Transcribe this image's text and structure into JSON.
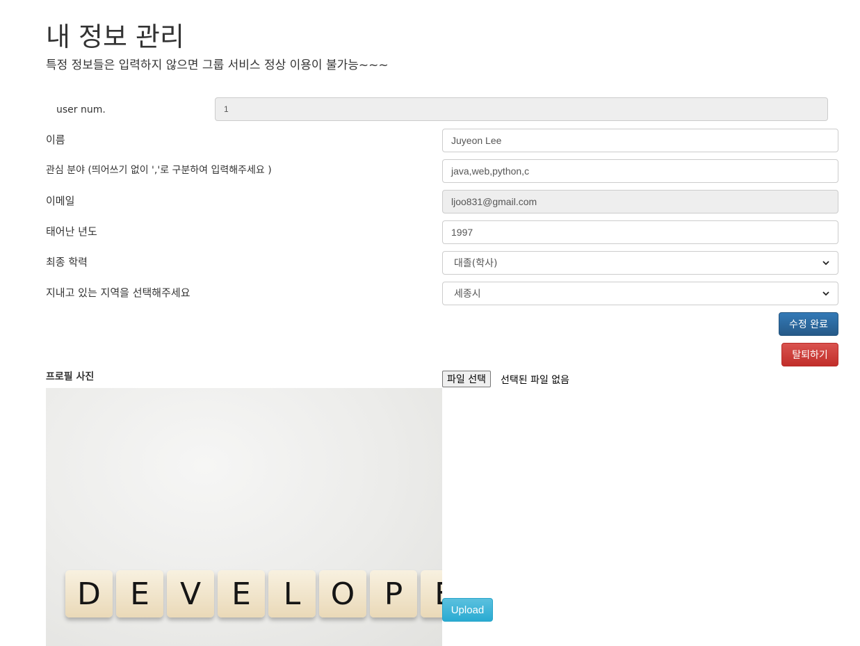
{
  "header": {
    "title": "내 정보 관리",
    "subtitle": "특정 정보들은 입력하지 않으면 그룹 서비스 정상 이용이 불가능~~~"
  },
  "form": {
    "user_num": {
      "label": "user num.",
      "value": "1"
    },
    "name": {
      "label": "이름",
      "value": "Juyeon Lee"
    },
    "interests": {
      "label": "관심 분야 (띄어쓰기 없이 ','로 구분하여 입력해주세요 )",
      "value": "java,web,python,c"
    },
    "email": {
      "label": "이메일",
      "value": "ljoo831@gmail.com"
    },
    "birth_year": {
      "label": "태어난 년도",
      "value": "1997"
    },
    "education": {
      "label": "최종 학력",
      "value": "대졸(학사)"
    },
    "region": {
      "label": "지내고 있는 지역을 선택해주세요",
      "value": "세종시"
    }
  },
  "buttons": {
    "save": "수정 완료",
    "withdraw": "탈퇴하기",
    "upload": "Upload"
  },
  "profile": {
    "label": "프로필 사진",
    "file_button": "파일 선택",
    "file_status": "선택된 파일 없음",
    "photo_tiles": [
      "D",
      "E",
      "V",
      "E",
      "L",
      "O",
      "P",
      "E"
    ]
  },
  "colors": {
    "primary": "#337ab7",
    "danger": "#d9534f",
    "info": "#5bc0de"
  }
}
